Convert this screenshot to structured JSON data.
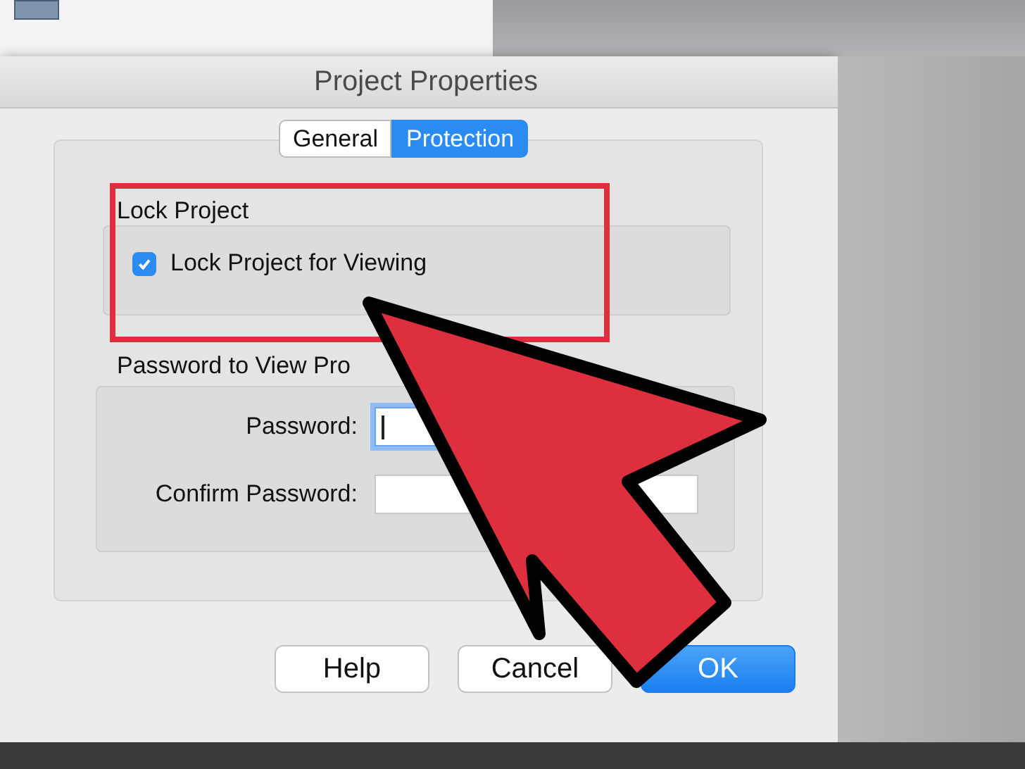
{
  "dialog": {
    "title": "Project Properties"
  },
  "tabs": [
    {
      "label": "General",
      "selected": false
    },
    {
      "label": "Protection",
      "selected": true
    }
  ],
  "lock_group": {
    "title": "Lock Project",
    "checkbox": {
      "label": "Lock Project for Viewing",
      "checked": true
    }
  },
  "password_group": {
    "title": "Password to View Pro",
    "fields": [
      {
        "label": "Password:",
        "focused": true
      },
      {
        "label": "Confirm Password:",
        "focused": false
      }
    ]
  },
  "buttons": [
    {
      "label": "Help",
      "default": false
    },
    {
      "label": "Cancel",
      "default": false
    },
    {
      "label": "OK",
      "default": true
    }
  ]
}
